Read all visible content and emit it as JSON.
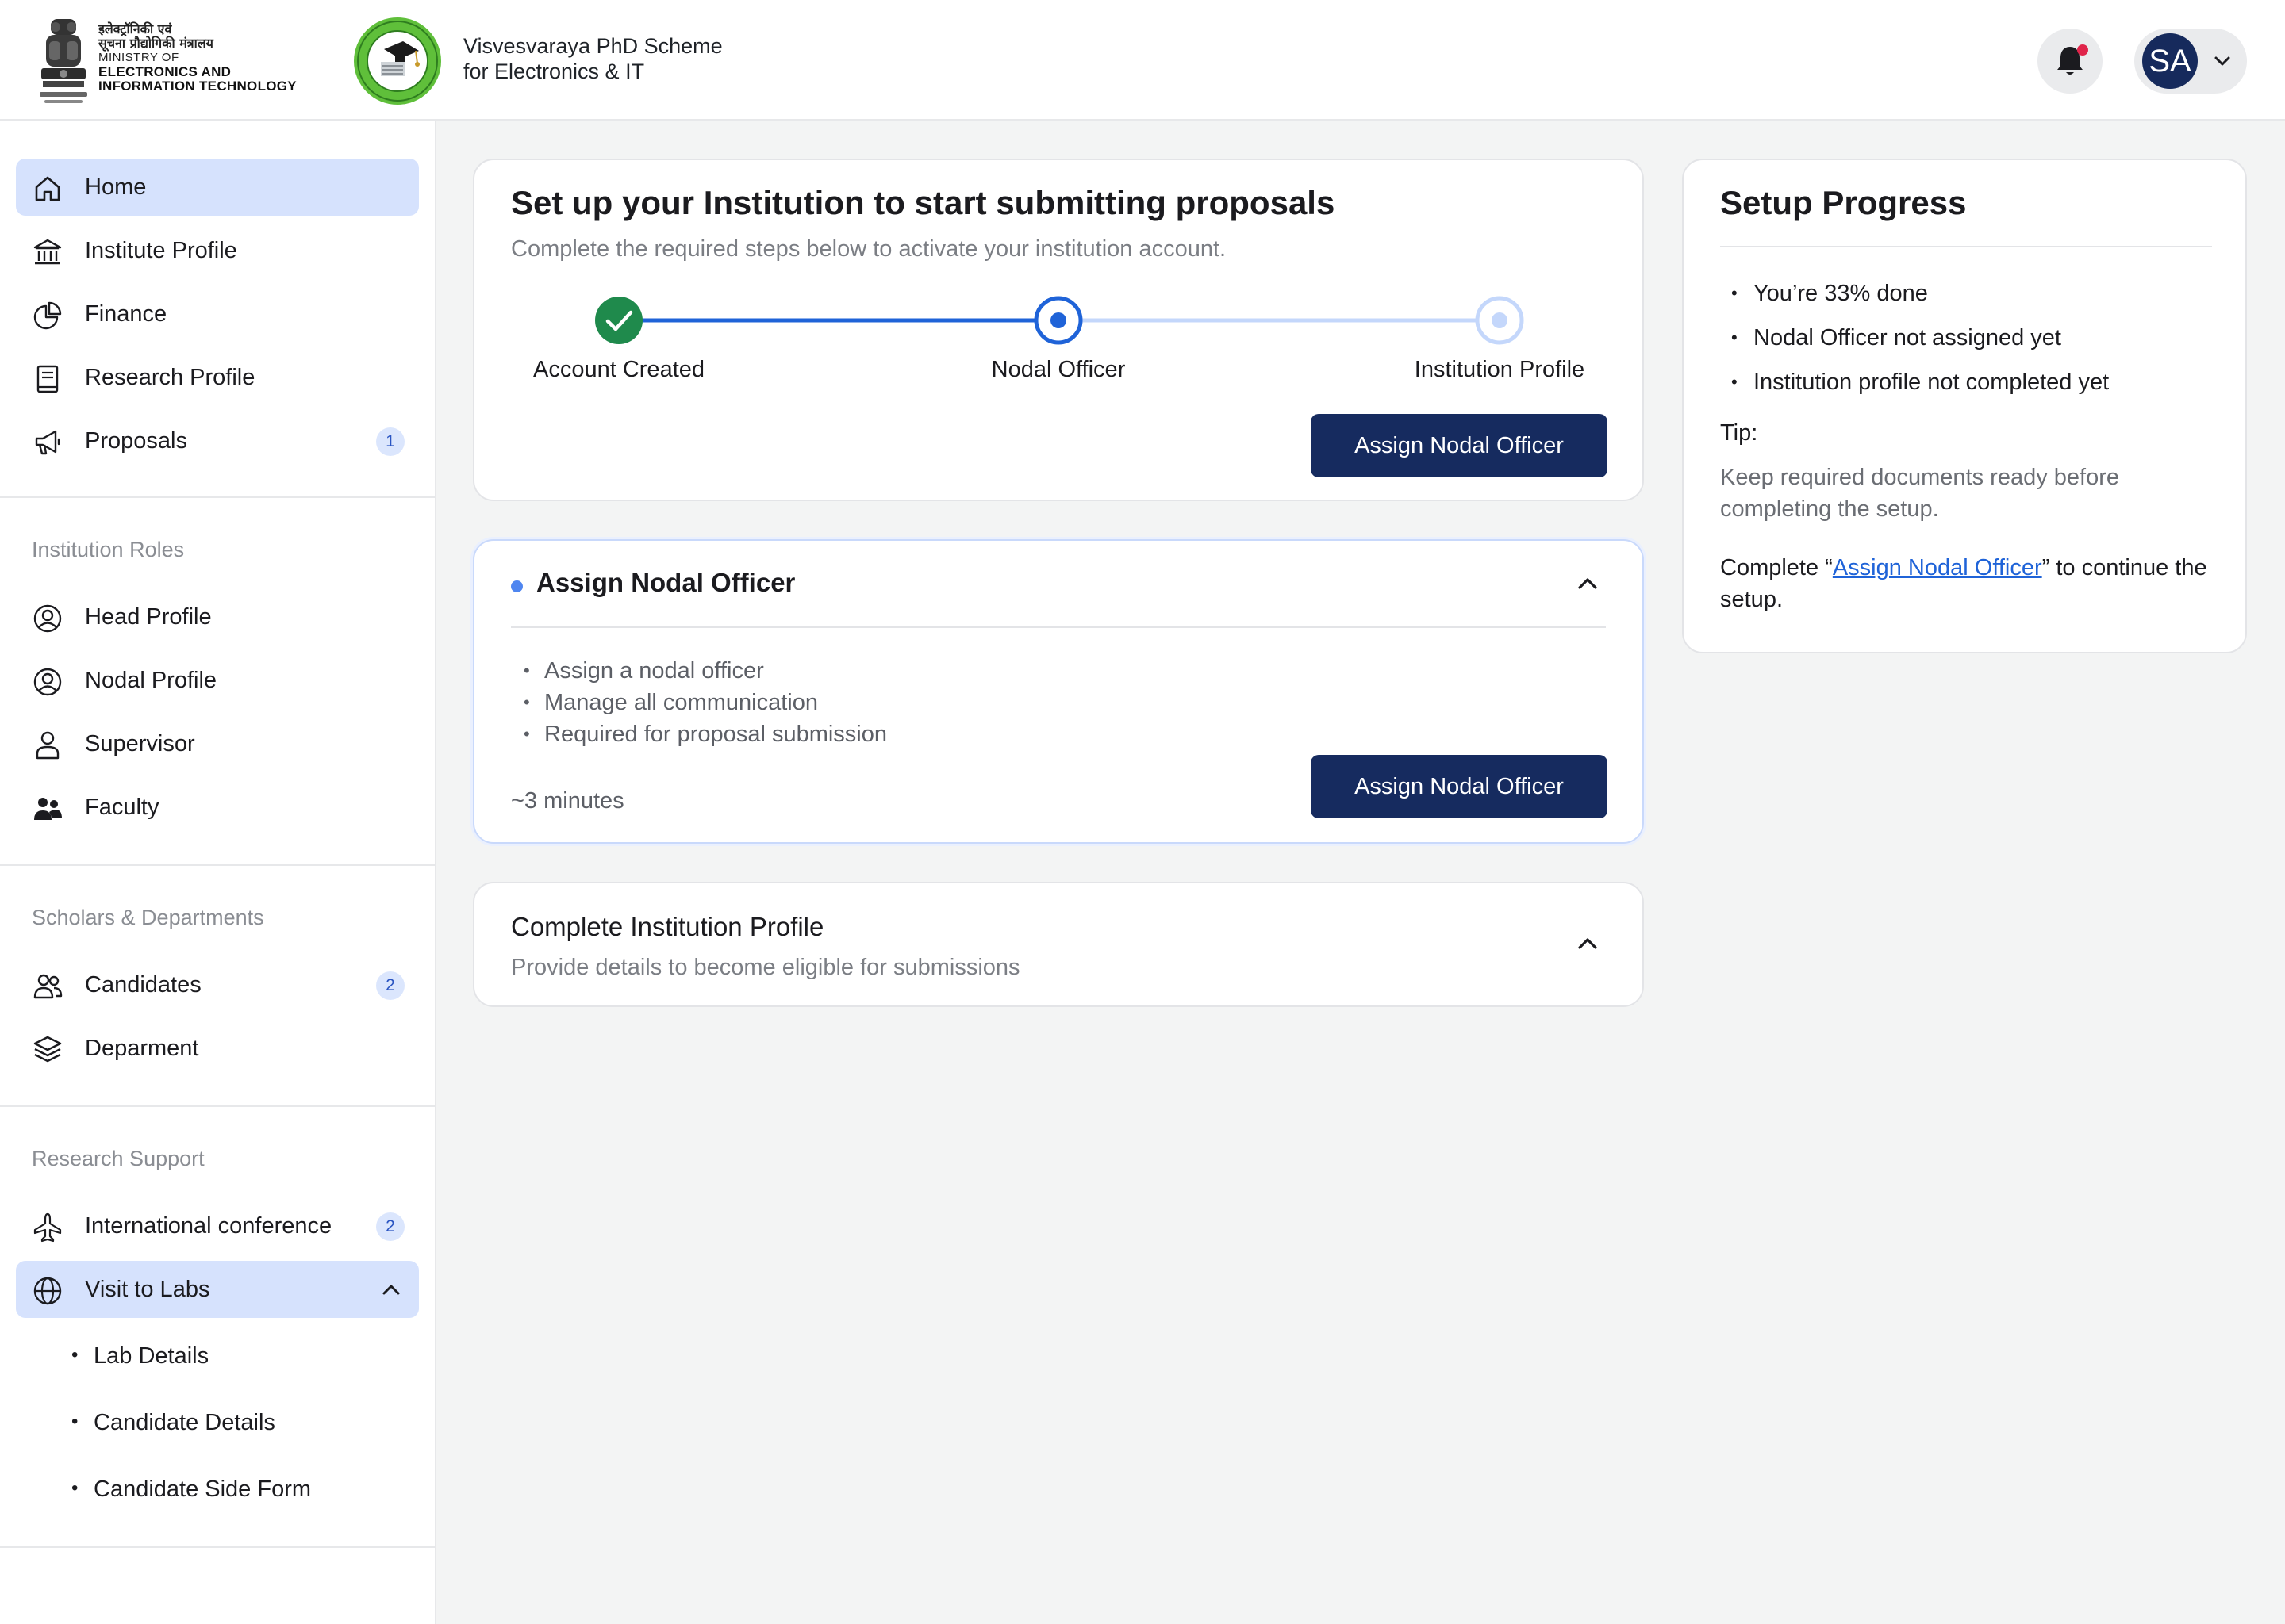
{
  "header": {
    "ministry_hindi_line1": "इलेक्ट्रॉनिकी एवं",
    "ministry_hindi_line2": "सूचना प्रौद्योगिकी मंत्रालय",
    "ministry_line1": "MINISTRY OF",
    "ministry_line2": "ELECTRONICS AND",
    "ministry_line3": "INFORMATION TECHNOLOGY",
    "scheme_line1": "Visvesvaraya PhD Scheme",
    "scheme_line2": "for Electronics & IT",
    "user_initials": "SA"
  },
  "sidebar": {
    "main_items": [
      {
        "label": "Home",
        "icon": "home-icon",
        "active": true
      },
      {
        "label": "Institute Profile",
        "icon": "institution-icon"
      },
      {
        "label": "Finance",
        "icon": "pie-chart-icon"
      },
      {
        "label": "Research Profile",
        "icon": "notebook-icon"
      },
      {
        "label": "Proposals",
        "icon": "megaphone-icon",
        "badge": "1"
      }
    ],
    "institution_roles": {
      "title": "Institution Roles",
      "items": [
        {
          "label": "Head Profile",
          "icon": "user-circle-icon"
        },
        {
          "label": "Nodal Profile",
          "icon": "user-circle-icon"
        },
        {
          "label": "Supervisor",
          "icon": "person-icon"
        },
        {
          "label": "Faculty",
          "icon": "group-icon"
        }
      ]
    },
    "scholars": {
      "title": "Scholars & Departments",
      "items": [
        {
          "label": "Candidates",
          "icon": "users-icon",
          "badge": "2"
        },
        {
          "label": "Deparment",
          "icon": "layers-icon"
        }
      ]
    },
    "research_support": {
      "title": "Research Support",
      "items": [
        {
          "label": "International conference",
          "icon": "airplane-icon",
          "badge": "2"
        },
        {
          "label": "Visit to Labs",
          "icon": "globe-icon",
          "active": true,
          "expanded": true
        }
      ],
      "sub_items": [
        "Lab Details",
        "Candidate Details",
        "Candidate Side Form"
      ]
    }
  },
  "setup": {
    "title": "Set up your Institution to start submitting proposals",
    "subtitle": "Complete the required steps below to activate your institution account.",
    "steps": [
      {
        "label": "Account Created",
        "state": "done"
      },
      {
        "label": "Nodal Officer",
        "state": "current"
      },
      {
        "label": "Institution Profile",
        "state": "upcoming"
      }
    ],
    "button_label": "Assign Nodal Officer"
  },
  "assign_card": {
    "title": "Assign Nodal Officer",
    "bullets": [
      "Assign a nodal officer",
      "Manage all communication",
      "Required for proposal submission"
    ],
    "time": "~3 minutes",
    "button_label": "Assign Nodal Officer"
  },
  "profile_card": {
    "title": "Complete Institution Profile",
    "subtitle": "Provide details to become eligible for submissions"
  },
  "progress": {
    "title": "Setup Progress",
    "items": [
      "You’re 33% done",
      "Nodal Officer not assigned yet",
      "Institution profile not completed yet"
    ],
    "percent_done": 33,
    "tip_label": "Tip:",
    "tip_text": "Keep required documents ready before completing the setup.",
    "action_prefix": "Complete “",
    "action_link": "Assign Nodal Officer",
    "action_suffix": "” to continue the setup."
  },
  "colors": {
    "primary": "#162b5f",
    "accent": "#1f63d8",
    "active_nav": "#d6e2fd",
    "success": "#1f8a4c"
  }
}
